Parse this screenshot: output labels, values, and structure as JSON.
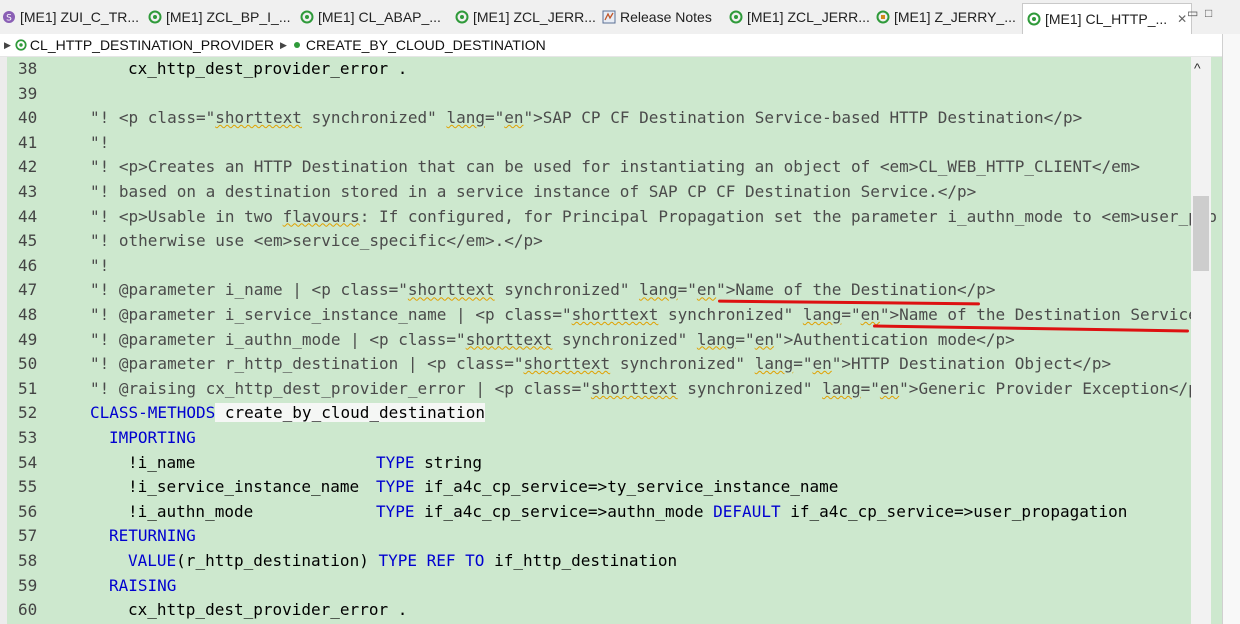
{
  "tabs": [
    {
      "label": "[ME1] ZUI_C_TR...",
      "icon": "cds-icon"
    },
    {
      "label": "[ME1] ZCL_BP_I_...",
      "icon": "class-icon"
    },
    {
      "label": "[ME1] CL_ABAP_...",
      "icon": "class-icon"
    },
    {
      "label": "[ME1] ZCL_JERR...",
      "icon": "class-icon"
    },
    {
      "label": "Release Notes",
      "icon": "doc-icon"
    },
    {
      "label": "[ME1] ZCL_JERR...",
      "icon": "class-icon"
    },
    {
      "label": "[ME1] Z_JERRY_...",
      "icon": "program-icon"
    },
    {
      "label": "[ME1] CL_HTTP_...",
      "icon": "class-icon",
      "close": "✕"
    }
  ],
  "window": {
    "minimize": "▭",
    "maximize": "□"
  },
  "breadcrumb": {
    "class_name": "CL_HTTP_DESTINATION_PROVIDER",
    "method_name": "CREATE_BY_CLOUD_DESTINATION"
  },
  "lines": [
    {
      "num": "38"
    },
    {
      "num": "39"
    },
    {
      "num": "40"
    },
    {
      "num": "41"
    },
    {
      "num": "42"
    },
    {
      "num": "43"
    },
    {
      "num": "44"
    },
    {
      "num": "45"
    },
    {
      "num": "46"
    },
    {
      "num": "47"
    },
    {
      "num": "48"
    },
    {
      "num": "49"
    },
    {
      "num": "50"
    },
    {
      "num": "51"
    },
    {
      "num": "52"
    },
    {
      "num": "53"
    },
    {
      "num": "54"
    },
    {
      "num": "55"
    },
    {
      "num": "56"
    },
    {
      "num": "57"
    },
    {
      "num": "58"
    },
    {
      "num": "59"
    },
    {
      "num": "60"
    }
  ],
  "code": {
    "l38": "cx_http_dest_provider_error .",
    "l40a": "\"! <p class=\"",
    "l40b": "shorttext",
    "l40c": " synchronized\" ",
    "l40d": "lang",
    "l40e": "=\"",
    "l40f": "en",
    "l40g": "\">SAP CP CF Destination Service-based HTTP Destination</p>",
    "l41": "\"!",
    "l42": "\"! <p>Creates an HTTP Destination that can be used for instantiating an object of <em>CL_WEB_HTTP_CLIENT</em>",
    "l43": "\"! based on a destination stored in a service instance of SAP CP CF Destination Service.</p>",
    "l44a": "\"! <p>Usable in two ",
    "l44b": "flavours",
    "l44c": ": If configured, for Principal Propagation set the parameter i_authn_mode to <em>user_pro",
    "l45": "\"! otherwise use <em>service_specific</em>.</p>",
    "l46": "\"!",
    "l47a": "\"! @parameter i_name | <p class=\"",
    "l47b": "shorttext",
    "l47c": " synchronized\" ",
    "l47d": "lang",
    "l47e": "=\"",
    "l47f": "en",
    "l47g": "\">Name of the Destination</p>",
    "l48a": "\"! @parameter i_service_instance_name | <p class=\"",
    "l48b": "shorttext",
    "l48c": " synchronized\" ",
    "l48d": "lang",
    "l48e": "=\"",
    "l48f": "en",
    "l48g": "\">Name of the Destination Service",
    "l49a": "\"! @parameter i_authn_mode | <p class=\"",
    "l49b": "shorttext",
    "l49c": " synchronized\" ",
    "l49d": "lang",
    "l49e": "=\"",
    "l49f": "en",
    "l49g": "\">Authentication mode</p>",
    "l50a": "\"! @parameter r_http_destination | <p class=\"",
    "l50b": "shorttext",
    "l50c": " synchronized\" ",
    "l50d": "lang",
    "l50e": "=\"",
    "l50f": "en",
    "l50g": "\">HTTP Destination Object</p>",
    "l51a": "\"! @raising cx_http_dest_provider_error | <p class=\"",
    "l51b": "shorttext",
    "l51c": " synchronized\" ",
    "l51d": "lang",
    "l51e": "=\"",
    "l51f": "en",
    "l51g": "\">Generic Provider Exception</p>",
    "l52kw": "CLASS-METHODS",
    "l52name": " create_by_cloud_destination",
    "l53": "IMPORTING",
    "l54p": "!i_name",
    "l54kw": "TYPE",
    "l54t": " string",
    "l55p": "!i_service_instance_name",
    "l55kw": "TYPE",
    "l55t": " if_a4c_cp_service=>ty_service_instance_name",
    "l56p": "!i_authn_mode",
    "l56kw": "TYPE",
    "l56t": " if_a4c_cp_service=>authn_mode ",
    "l56kw2": "DEFAULT",
    "l56t2": " if_a4c_cp_service=>user_propagation",
    "l57": "RETURNING",
    "l58kw": "VALUE",
    "l58p": "(r_http_destination) ",
    "l58kw2": "TYPE REF TO",
    "l58t": " if_http_destination",
    "l59": "RAISING",
    "l60": "cx_http_dest_provider_error ."
  },
  "scrollbar": {
    "up_arrow": "^"
  },
  "colors": {
    "editor_bg": "#cde8ce",
    "keyword": "#0000d0",
    "annotation": "#dd1111"
  }
}
